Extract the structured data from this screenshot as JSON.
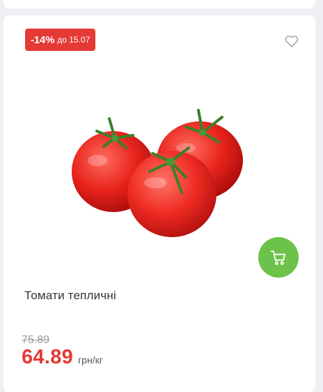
{
  "product": {
    "discount": "-14%",
    "discount_until": "до 15.07",
    "title": "Томати тепличні",
    "old_price": "75.89",
    "price": "64.89",
    "unit": "грн/кг",
    "image": "tomatoes-image"
  },
  "icons": {
    "favorite": "heart-outline-icon",
    "cart": "cart-icon"
  },
  "colors": {
    "badge": "#e53935",
    "price": "#e53935",
    "cart_button": "#6cc24a",
    "old_price": "#9a9a9a"
  }
}
